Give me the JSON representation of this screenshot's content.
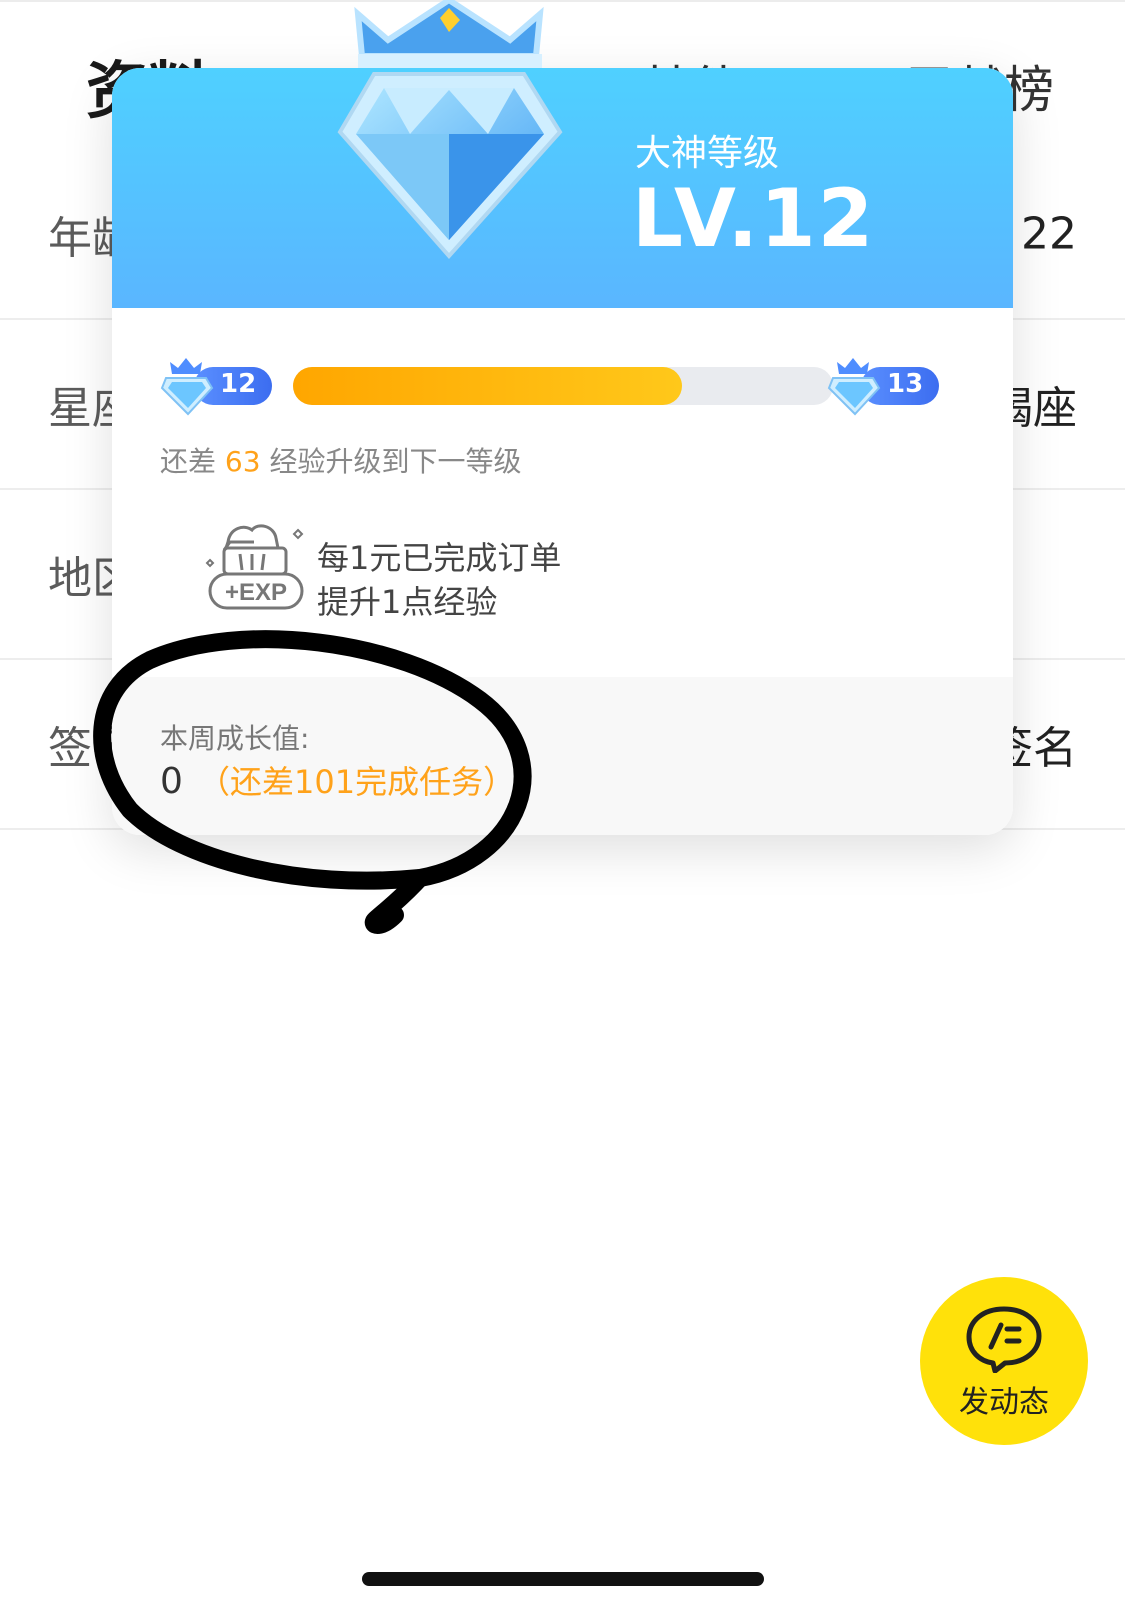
{
  "background": {
    "tabs": [
      {
        "label": "资料"
      },
      {
        "label": "技能"
      },
      {
        "label": "贡献榜"
      }
    ],
    "rows": [
      {
        "label": "年龄",
        "value": "22"
      },
      {
        "label": "星座",
        "value": "摩羯座"
      },
      {
        "label": "地区",
        "value": ""
      },
      {
        "label": "签名",
        "value": "个性签名"
      }
    ]
  },
  "popup": {
    "subtitle": "大神等级",
    "level": "LV.12",
    "progress": {
      "current_level": "12",
      "next_level": "13",
      "fraction": 0.72
    },
    "remaining": {
      "prefix": "还差",
      "amount": "63",
      "suffix": "经验升级到下一等级"
    },
    "exp_icon_label": "+EXP",
    "exp_rule": {
      "line1": "每1元已完成订单",
      "line2": "提升1点经验"
    },
    "weekly": {
      "label": "本周成长值:",
      "value": "0",
      "hint": "（还差101完成任务）"
    }
  },
  "fab": {
    "label": "发动态"
  },
  "colors": {
    "header_gradient_top": "#4fd0ff",
    "header_gradient_bottom": "#5ab6ff",
    "progress_fill": "#ffb400",
    "highlight": "#ffa21a",
    "fab": "#ffe10a"
  }
}
